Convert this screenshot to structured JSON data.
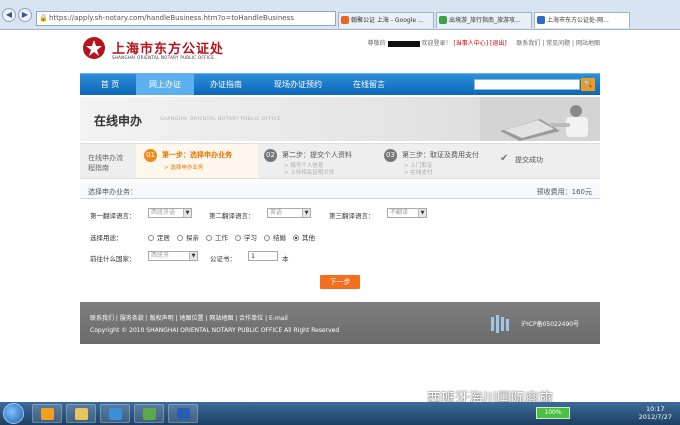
{
  "browser": {
    "url": "https://apply.sh-notary.com/handleBusiness.htm?o=toHandleBusiness",
    "nav": [
      "◀",
      "▶"
    ],
    "tabs": [
      {
        "label": "翰聚公证 上海 - Google ...",
        "icon_color": "#e8661d",
        "active": false
      },
      {
        "label": "出境游_旅行指南_旅游攻...",
        "icon_color": "#3aa04a",
        "active": false
      },
      {
        "label": "上海市东方公证处-网...",
        "icon_color": "#2f6bc0",
        "active": true
      }
    ]
  },
  "header": {
    "logo_cn": "上海市东方公证处",
    "logo_en": "SHANGHAI ORIENTAL NOTARY PUBLIC OFFICE",
    "welcome_prefix": "尊敬的",
    "welcome_suffix": "欢迎登录！",
    "user_center": "[当事人中心]",
    "logout": "[退出]",
    "links": [
      "联系我们",
      "常见问题",
      "网站地图"
    ]
  },
  "mainnav": {
    "items": [
      "首 页",
      "网上办证",
      "办证指南",
      "现场办证预约",
      "在线留言"
    ],
    "active_index": 1,
    "search_icon": "search-icon"
  },
  "banner": {
    "title": "在线申办",
    "subtitle": "SHANGHAI ORIENTAL NOTARY PUBLIC OFFICE"
  },
  "steps": {
    "label": "在线申办流程指南",
    "items": [
      {
        "num": "01",
        "title": "第一步：选择申办业务",
        "subs": [
          "> 选择申办业务"
        ],
        "active": true
      },
      {
        "num": "02",
        "title": "第二步：提交个人资料",
        "subs": [
          "> 填写个人信息",
          "> 上传相关证明文件"
        ],
        "active": false
      },
      {
        "num": "03",
        "title": "第三步：取证及费用支付",
        "subs": [
          "> 上门取证",
          "> 在线支付"
        ],
        "active": false
      }
    ],
    "done": "提交成功"
  },
  "form": {
    "title": "选择申办业务：",
    "fee_label": "预收费用：160元",
    "lang1_label": "第一翻译语言：",
    "lang1_value": "西班牙语",
    "lang2_label": "第二翻译语言：",
    "lang2_value": "英语",
    "lang3_label": "第三翻译语言：",
    "lang3_value": "不翻译",
    "purpose_label": "选择用途：",
    "purposes": [
      "定居",
      "探亲",
      "工作",
      "学习",
      "结婚",
      "其他"
    ],
    "purpose_selected": 5,
    "country_label": "前往什么国家：",
    "country_value": "西班牙",
    "copies_label": "公证书：",
    "copies_value": "1",
    "copies_unit": "本",
    "next_button": "下一步"
  },
  "footer": {
    "links": "联系我们 | 服务条款 | 版权声明 | 地图位置 | 网站地图 | 合作单位 | E-mail",
    "copyright": "Copyright © 2010 SHANGHAI ORIENTAL NOTARY PUBLIC OFFICE All Right Reserved",
    "icp": "沪ICP备05022490号"
  },
  "watermark": "西班牙海川国际商旅",
  "taskbar": {
    "battery": "100%",
    "time": "10:17",
    "date": "2012/7/27",
    "apps": [
      {
        "icon": "outlook-icon",
        "color": "#f0a020"
      },
      {
        "icon": "explorer-icon",
        "color": "#e8c560"
      },
      {
        "icon": "media-player-icon",
        "color": "#3a8fd8"
      },
      {
        "icon": "network-app-icon",
        "color": "#5fa84a"
      },
      {
        "icon": "word-icon",
        "color": "#2a5db0"
      }
    ]
  }
}
